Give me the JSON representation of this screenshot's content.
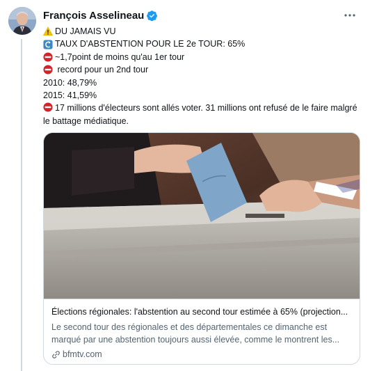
{
  "tweet": {
    "author": "François Asselineau",
    "lines": [
      "DU JAMAIS VU",
      "TAUX D'ABSTENTION POUR LE 2e TOUR: 65%",
      "~1,7point de moins qu'au 1er tour",
      " record pour un 2nd tour",
      "2010: 48,79%",
      "2015: 41,59%",
      "17 millions d'électeurs sont allés voter. 31 millions ont refusé de le faire malgré le battage médiatique."
    ]
  },
  "card": {
    "title": "Élections régionales: l'abstention au second tour estimée à 65% (projection...",
    "description": "Le second tour des régionales et des départementales ce dimanche est marqué par une abstention toujours aussi élevée, comme le montrent les...",
    "domain": "bfmtv.com"
  },
  "colors": {
    "verified": "#1d9bf0",
    "warning": "#f5c400",
    "no_entry": "#d0242b",
    "arrow_box": "#3b88c3"
  }
}
